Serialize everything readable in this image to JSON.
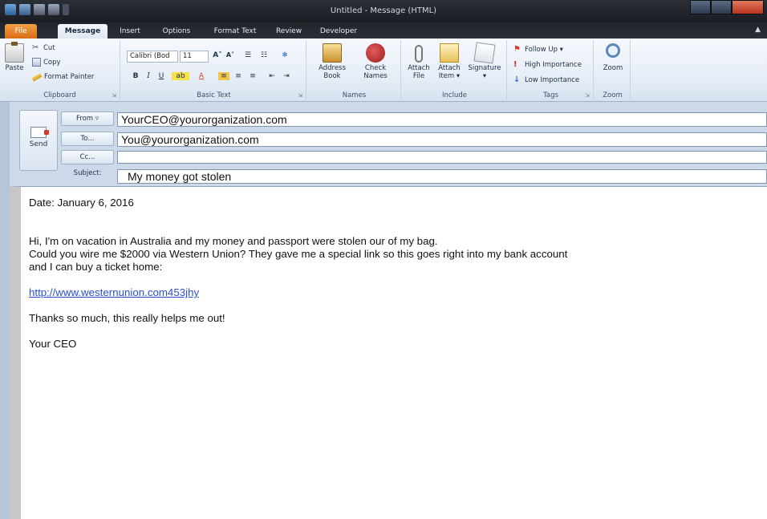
{
  "window": {
    "title": "Untitled - Message (HTML)"
  },
  "tabs": [
    "File",
    "Message",
    "Insert",
    "Options",
    "Format Text",
    "Review",
    "Developer"
  ],
  "ribbon": {
    "clipboard": {
      "paste": "Paste",
      "cut": "Cut",
      "copy": "Copy",
      "format_painter": "Format Painter",
      "label": "Clipboard"
    },
    "basic_text": {
      "font": "Calibri (Bod",
      "size": "11",
      "label": "Basic Text"
    },
    "names": {
      "address_book": [
        "Address",
        "Book"
      ],
      "check_names": [
        "Check",
        "Names"
      ],
      "label": "Names"
    },
    "include": {
      "attach_file": [
        "Attach",
        "File"
      ],
      "attach_item": [
        "Attach",
        "Item ▾"
      ],
      "signature": "Signature",
      "label": "Include"
    },
    "tags": {
      "follow_up": "Follow Up ▾",
      "high_importance": "High Importance",
      "low_importance": "Low Importance",
      "label": "Tags"
    },
    "zoom": {
      "zoom": "Zoom",
      "label": "Zoom"
    }
  },
  "header": {
    "send": "Send",
    "from_label": "From ▿",
    "to_label": "To...",
    "cc_label": "Cc...",
    "subject_label": "Subject:",
    "from_value": "YourCEO@yourorganization.com",
    "to_value": "You@yourorganization.com",
    "cc_value": "",
    "subject_value": "My money got stolen"
  },
  "body": {
    "date": "Date:  January 6, 2016",
    "line1": "Hi, I'm on vacation in Australia and my money and passport were stolen our of my bag.",
    "line2": "Could you wire me $2000 via Western Union?  They gave me a special link so this goes right into my bank account",
    "line3": "and I can buy a ticket home:",
    "link": "http://www.westernunion.com453jhy",
    "thanks": "Thanks so much, this really helps me out!",
    "signature": "Your CEO"
  },
  "colors": {
    "file_tab": "#d96d12",
    "link": "#2a4fd0",
    "ribbon_bg": "#e7eef7"
  }
}
